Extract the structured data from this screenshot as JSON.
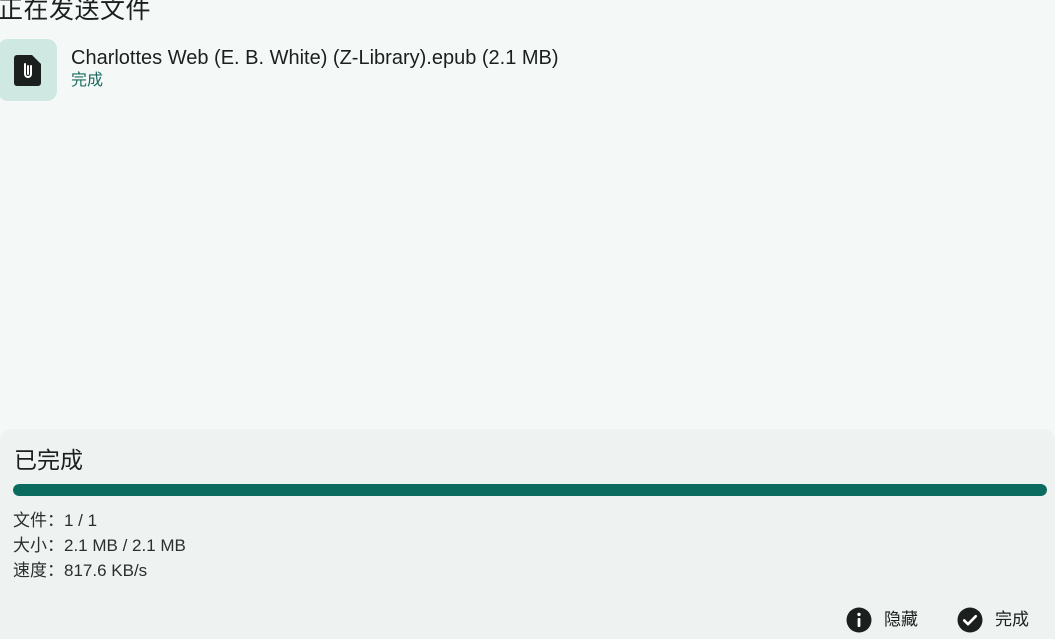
{
  "page": {
    "title": "正在发送文件"
  },
  "files": [
    {
      "name": "Charlottes Web (E. B. White) (Z-Library).epub (2.1 MB)",
      "status": "完成",
      "icon": "attachment-file-icon"
    }
  ],
  "summary": {
    "status_title": "已完成",
    "progress_percent": 100,
    "files_line": "文件：1 / 1",
    "size_line": "大小：2.1 MB / 2.1 MB",
    "speed_line": "速度：817.6 KB/s"
  },
  "actions": {
    "hide_label": "隐藏",
    "done_label": "完成"
  },
  "colors": {
    "background": "#f4f9f7",
    "panel": "#eef3f1",
    "accent": "#0c6b5f",
    "icon_tile": "#cfe8e2"
  }
}
